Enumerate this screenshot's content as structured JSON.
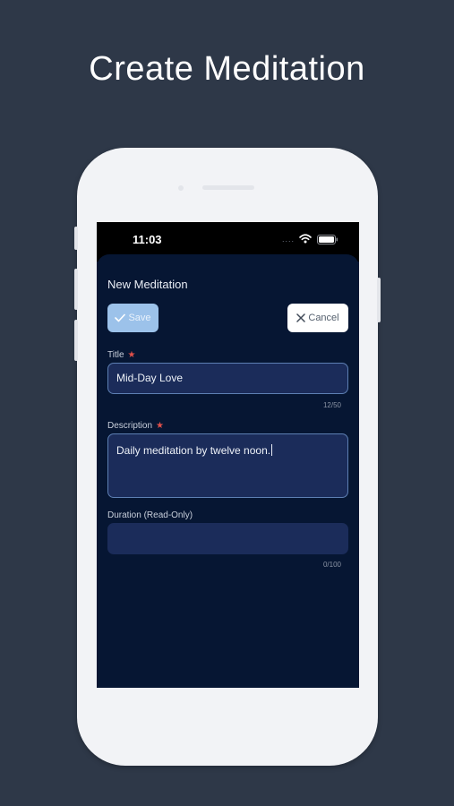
{
  "headline": "Create Meditation",
  "status_bar": {
    "time": "11:03",
    "signal": "....",
    "icons": [
      "wifi-icon",
      "battery-icon"
    ]
  },
  "form": {
    "sheet_title": "New Meditation",
    "save_label": "Save",
    "cancel_label": "Cancel",
    "fields": [
      {
        "label": "Title",
        "required": true,
        "value": "Mid-Day Love",
        "counter": "12/50"
      },
      {
        "label": "Description",
        "required": true,
        "value": "Daily meditation by twelve noon.",
        "counter": ""
      },
      {
        "label": "Duration (Read-Only)",
        "required": false,
        "value": "",
        "counter": "0/100"
      }
    ]
  },
  "colors": {
    "background": "#2e3848",
    "screen": "#061633",
    "input_fill": "#1b2c5a",
    "input_border": "#5d7fb3",
    "save_button": "#9cc2ea",
    "required_star": "#e0504a"
  }
}
